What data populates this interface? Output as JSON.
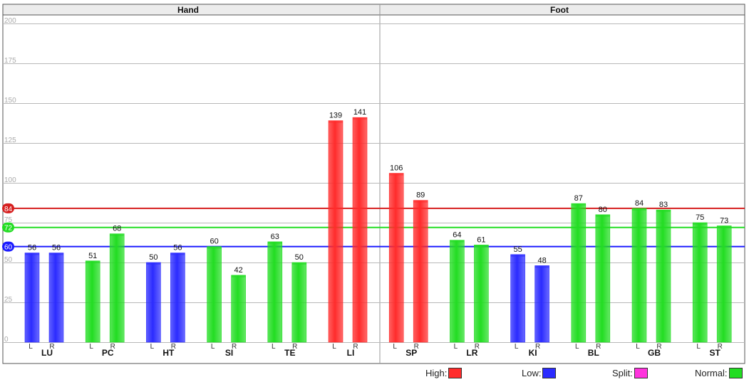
{
  "panels": [
    "Hand",
    "Foot"
  ],
  "colors": {
    "high": "#ff2b2b",
    "low": "#2b2bff",
    "split": "#ff33dd",
    "normal": "#22dd22",
    "high_line": "#d62020",
    "low_line": "#1a1aff",
    "normal_line": "#22dd22"
  },
  "legend": {
    "high": "High:",
    "low": "Low:",
    "split": "Split:",
    "normal": "Normal:"
  },
  "chart_data": {
    "type": "bar",
    "ylim": [
      0,
      200
    ],
    "yticks": [
      "0",
      "25",
      "50",
      "75",
      "100",
      "125",
      "150",
      "175",
      "200"
    ],
    "sides": [
      "L",
      "R"
    ],
    "reference_lines": [
      {
        "label": "84",
        "value": 84,
        "status": "high"
      },
      {
        "label": "72",
        "value": 72,
        "status": "normal"
      },
      {
        "label": "60",
        "value": 60,
        "status": "low"
      }
    ],
    "groups": [
      {
        "name": "LU",
        "panel": "Hand",
        "bars": [
          {
            "side": "L",
            "value": 56,
            "status": "low"
          },
          {
            "side": "R",
            "value": 56,
            "status": "low"
          }
        ]
      },
      {
        "name": "PC",
        "panel": "Hand",
        "bars": [
          {
            "side": "L",
            "value": 51,
            "status": "normal"
          },
          {
            "side": "R",
            "value": 68,
            "status": "normal"
          }
        ]
      },
      {
        "name": "HT",
        "panel": "Hand",
        "bars": [
          {
            "side": "L",
            "value": 50,
            "status": "low"
          },
          {
            "side": "R",
            "value": 56,
            "status": "low"
          }
        ]
      },
      {
        "name": "SI",
        "panel": "Hand",
        "bars": [
          {
            "side": "L",
            "value": 60,
            "status": "normal"
          },
          {
            "side": "R",
            "value": 42,
            "status": "normal"
          }
        ]
      },
      {
        "name": "TE",
        "panel": "Hand",
        "bars": [
          {
            "side": "L",
            "value": 63,
            "status": "normal"
          },
          {
            "side": "R",
            "value": 50,
            "status": "normal"
          }
        ]
      },
      {
        "name": "LI",
        "panel": "Hand",
        "bars": [
          {
            "side": "L",
            "value": 139,
            "status": "high"
          },
          {
            "side": "R",
            "value": 141,
            "status": "high"
          }
        ]
      },
      {
        "name": "SP",
        "panel": "Foot",
        "bars": [
          {
            "side": "L",
            "value": 106,
            "status": "high"
          },
          {
            "side": "R",
            "value": 89,
            "status": "high"
          }
        ]
      },
      {
        "name": "LR",
        "panel": "Foot",
        "bars": [
          {
            "side": "L",
            "value": 64,
            "status": "normal"
          },
          {
            "side": "R",
            "value": 61,
            "status": "normal"
          }
        ]
      },
      {
        "name": "KI",
        "panel": "Foot",
        "bars": [
          {
            "side": "L",
            "value": 55,
            "status": "low"
          },
          {
            "side": "R",
            "value": 48,
            "status": "low"
          }
        ]
      },
      {
        "name": "BL",
        "panel": "Foot",
        "bars": [
          {
            "side": "L",
            "value": 87,
            "status": "normal"
          },
          {
            "side": "R",
            "value": 80,
            "status": "normal"
          }
        ]
      },
      {
        "name": "GB",
        "panel": "Foot",
        "bars": [
          {
            "side": "L",
            "value": 84,
            "status": "normal"
          },
          {
            "side": "R",
            "value": 83,
            "status": "normal"
          }
        ]
      },
      {
        "name": "ST",
        "panel": "Foot",
        "bars": [
          {
            "side": "L",
            "value": 75,
            "status": "normal"
          },
          {
            "side": "R",
            "value": 73,
            "status": "normal"
          }
        ]
      }
    ]
  }
}
